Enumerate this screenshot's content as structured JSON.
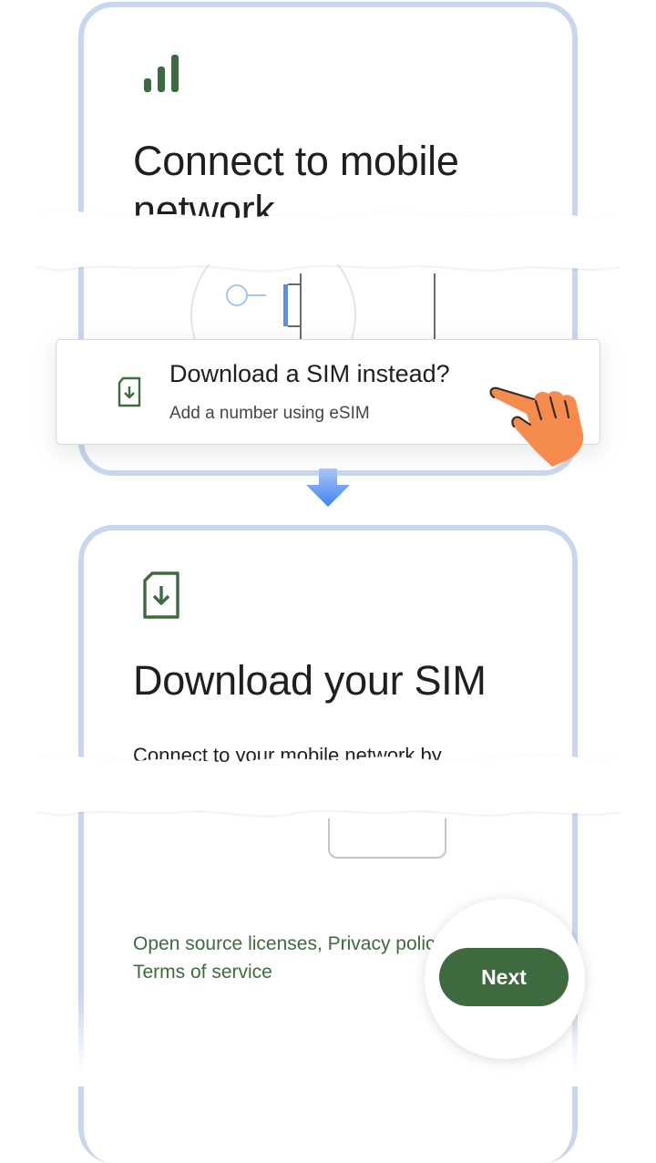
{
  "colors": {
    "accent_green": "#3e6a3f",
    "phone_frame": "#c9d7ee",
    "arrow_blue": "#4a8af4",
    "hand_orange": "#f58b4c"
  },
  "screen_top": {
    "icon": "signal-bars-icon",
    "title": "Connect to mobile network"
  },
  "sim_option": {
    "icon": "esim-download-icon",
    "title": "Download a SIM instead?",
    "subtitle": "Add a number using eSIM"
  },
  "transition": {
    "icon": "arrow-down-icon"
  },
  "screen_bottom": {
    "icon": "esim-download-icon",
    "title": "Download your SIM",
    "description": "Connect to your mobile network by"
  },
  "footer": {
    "open_source": "Open source licenses",
    "separator": ", ",
    "privacy": "Privacy policy",
    "terms": "Terms of service"
  },
  "next_button": {
    "label": "Next"
  }
}
